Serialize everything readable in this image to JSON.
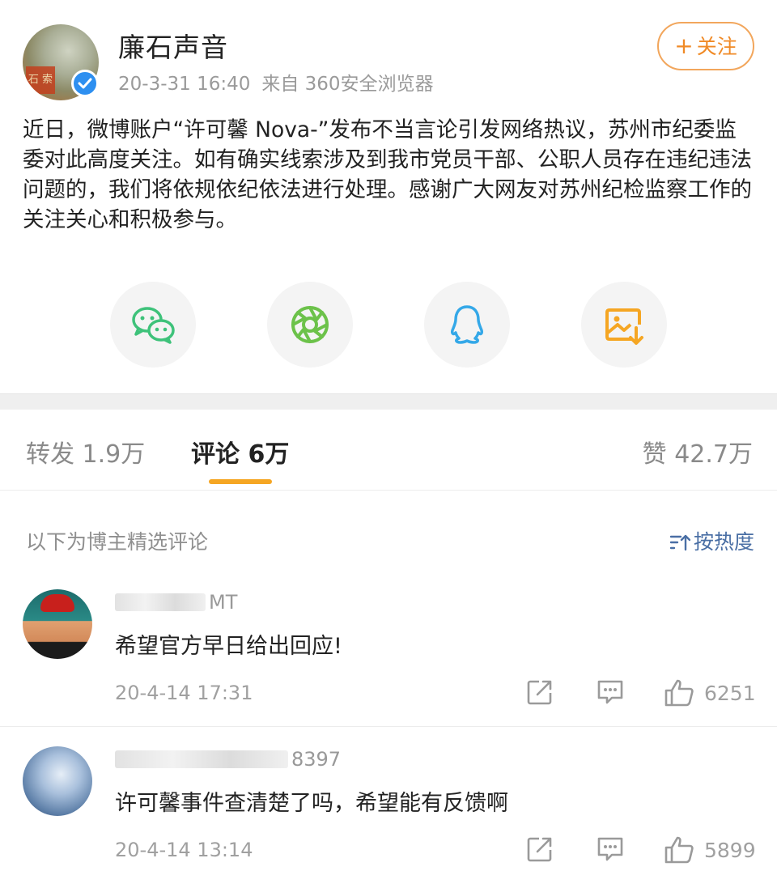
{
  "post": {
    "author": "廉石声音",
    "date": "20-3-31 16:40",
    "source": "来自 360安全浏览器",
    "follow_plus": "+",
    "follow_label": "关注",
    "avatar_seal": "石 索",
    "text": "近日，微博账户“许可馨 Nova-”发布不当言论引发网络热议，苏州市纪委监委对此高度关注。如有确实线索涉及到我市党员干部、公职人员存在违纪违法问题的，我们将依规依纪依法进行处理。感谢广大网友对苏州纪检监察工作的关注关心和积极参与。"
  },
  "share": [
    {
      "icon": "wechat-icon",
      "color": "#3ec27a"
    },
    {
      "icon": "moments-icon",
      "color": "#6cc24a"
    },
    {
      "icon": "qq-icon",
      "color": "#34a8e8"
    },
    {
      "icon": "save-image-icon",
      "color": "#f5a623"
    }
  ],
  "tabs": {
    "reposts": "转发 1.9万",
    "comments": "评论 6万",
    "likes": "赞 42.7万"
  },
  "comments_header": {
    "note": "以下为博主精选评论",
    "sort": "按热度"
  },
  "comments": [
    {
      "name_tail": "MT",
      "text": "希望官方早日给出回应!",
      "time": "20-4-14 17:31",
      "likes": "6251"
    },
    {
      "name_tail": "8397",
      "text": "许可馨事件查清楚了吗，希望能有反馈啊",
      "time": "20-4-14 13:14",
      "likes": "5899"
    }
  ],
  "colors": {
    "accent": "#f5a623",
    "follow": "#f08a26",
    "verified": "#2d8ff0",
    "sort": "#4a6fa5"
  }
}
